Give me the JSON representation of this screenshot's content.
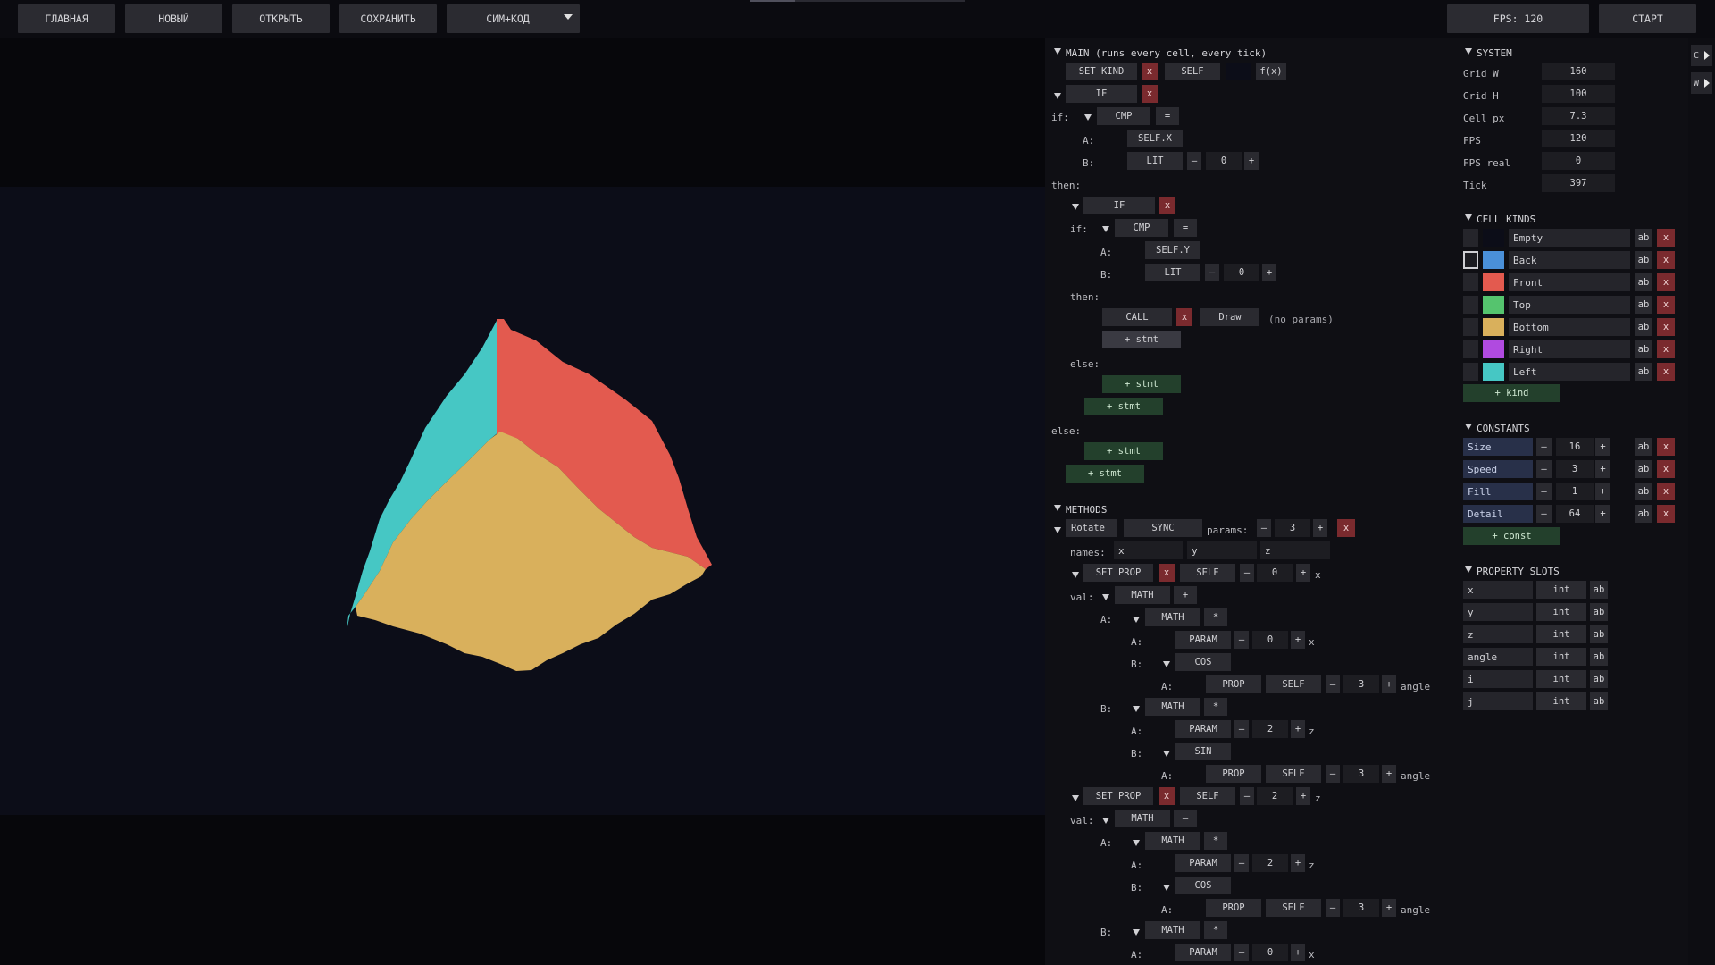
{
  "topbar": {
    "home": "ГЛАВНАЯ",
    "new": "НОВЫЙ",
    "open": "ОТКРЫТЬ",
    "save": "СОХРАНИТЬ",
    "mode": "СИМ+КОД",
    "fps": "FPS: 120",
    "start": "СТАРТ"
  },
  "rail": {
    "c": "C",
    "w": "W"
  },
  "code": {
    "main_header": "MAIN (runs every cell, every tick)",
    "set_kind": "SET KIND",
    "x": "x",
    "self": "SELF",
    "fx": "f(x)",
    "if": "IF",
    "if_label": "if:",
    "cmp": "CMP",
    "eq": "=",
    "a_label": "A:",
    "b_label": "B:",
    "self_x": "SELF.X",
    "self_y": "SELF.Y",
    "lit": "LIT",
    "minus": "–",
    "plus": "+",
    "zero": "0",
    "then": "then:",
    "else": "else:",
    "call": "CALL",
    "draw": "Draw",
    "no_params": "(no params)",
    "add_stmt": "+ stmt",
    "methods": "METHODS",
    "rotate": "Rotate",
    "sync": "SYNC",
    "params_label": "params:",
    "params_count": "3",
    "names_label": "names:",
    "name_x": "x",
    "name_y": "y",
    "name_z": "z",
    "set_prop": "SET PROP",
    "val_label": "val:",
    "math": "MATH",
    "op_plus": "+",
    "op_minus": "–",
    "op_mul": "*",
    "param": "PARAM",
    "prop": "PROP",
    "cos": "COS",
    "sin": "SIN",
    "n0": "0",
    "n2": "2",
    "n3": "3",
    "lx": "x",
    "lz": "z",
    "langle": "angle"
  },
  "system": {
    "title": "SYSTEM",
    "rows": [
      {
        "label": "Grid W",
        "value": "160"
      },
      {
        "label": "Grid H",
        "value": "100"
      },
      {
        "label": "Cell px",
        "value": "7.3"
      },
      {
        "label": "FPS",
        "value": "120"
      },
      {
        "label": "FPS real",
        "value": "0"
      },
      {
        "label": "Tick",
        "value": "397"
      }
    ]
  },
  "kinds": {
    "title": "CELL KINDS",
    "ab": "ab",
    "x": "x",
    "add": "+ kind",
    "items": [
      {
        "name": "Empty",
        "color": "#0c0d18"
      },
      {
        "name": "Back",
        "color": "#4a90d9"
      },
      {
        "name": "Front",
        "color": "#e35a4f"
      },
      {
        "name": "Top",
        "color": "#55c46e"
      },
      {
        "name": "Bottom",
        "color": "#d9b05c"
      },
      {
        "name": "Right",
        "color": "#b04ae0"
      },
      {
        "name": "Left",
        "color": "#46c7c4"
      }
    ]
  },
  "constants": {
    "title": "CONSTANTS",
    "minus": "–",
    "plus": "+",
    "ab": "ab",
    "x": "x",
    "add": "+ const",
    "items": [
      {
        "name": "Size",
        "value": "16"
      },
      {
        "name": "Speed",
        "value": "3"
      },
      {
        "name": "Fill",
        "value": "1"
      },
      {
        "name": "Detail",
        "value": "64"
      }
    ]
  },
  "slots": {
    "title": "PROPERTY SLOTS",
    "ab": "ab",
    "items": [
      {
        "name": "x",
        "type": "int"
      },
      {
        "name": "y",
        "type": "int"
      },
      {
        "name": "z",
        "type": "int"
      },
      {
        "name": "angle",
        "type": "int"
      },
      {
        "name": "i",
        "type": "int"
      },
      {
        "name": "j",
        "type": "int"
      }
    ]
  },
  "colors": {
    "left": "#46c7c4",
    "front": "#e35a4f",
    "bottom": "#d9b05c",
    "bg": "#0c0d18"
  }
}
